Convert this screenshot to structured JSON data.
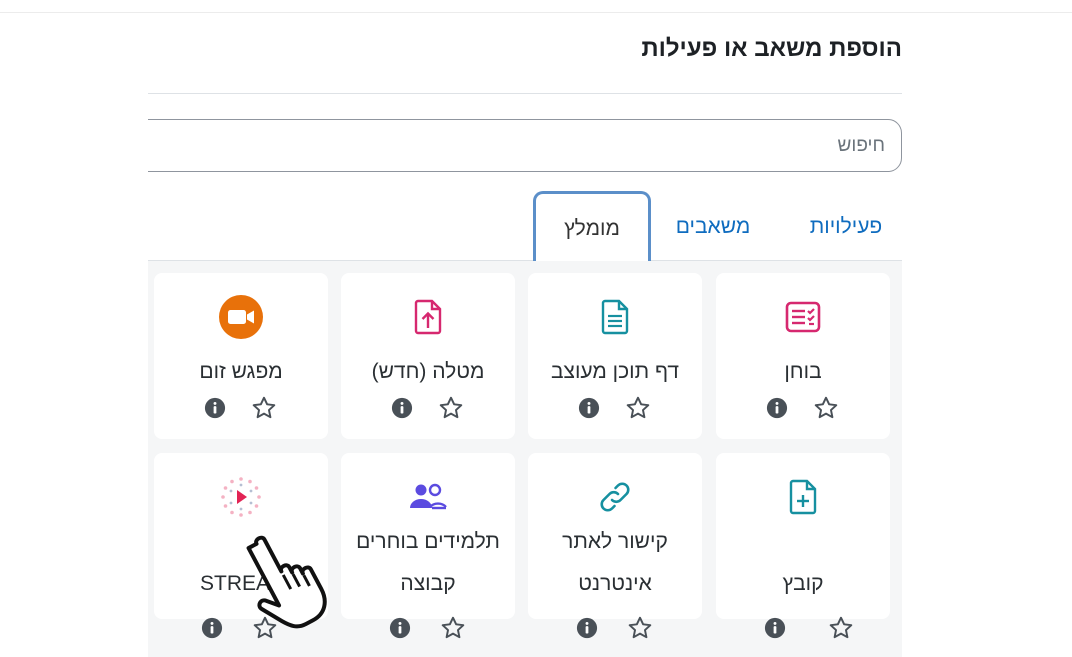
{
  "dialog": {
    "title": "הוספת משאב או פעילות",
    "search_placeholder": "חיפוש"
  },
  "tabs": [
    {
      "label": "פעילויות",
      "active": false
    },
    {
      "label": "משאבים",
      "active": false
    },
    {
      "label": "מומלץ",
      "active": true
    }
  ],
  "modules": [
    {
      "label": "בוחן",
      "icon": "quiz-icon",
      "color": "#d6286f"
    },
    {
      "label": "דף תוכן מעוצב",
      "icon": "page-icon",
      "color": "#1690a0"
    },
    {
      "label": "מטלה (חדש)",
      "icon": "assignment-upload-icon",
      "color": "#d6286f"
    },
    {
      "label": "מפגש זום",
      "icon": "zoom-video-icon",
      "color": "#e8710a"
    },
    {
      "label": "קובץ",
      "icon": "file-add-icon",
      "color": "#1690a0"
    },
    {
      "label": "קישור לאתר אינטרנט",
      "icon": "link-icon",
      "color": "#1690a0"
    },
    {
      "label": "תלמידים בוחרים קבוצה",
      "icon": "group-choice-icon",
      "color": "#5b4be0"
    },
    {
      "label": "STREAM",
      "icon": "stream-play-icon",
      "color": "#e22455"
    }
  ],
  "colors": {
    "link": "#0f6cbf",
    "active_tab_border": "#5b8fc9",
    "grid_background": "#f5f6f7",
    "action_icon": "#495057"
  }
}
